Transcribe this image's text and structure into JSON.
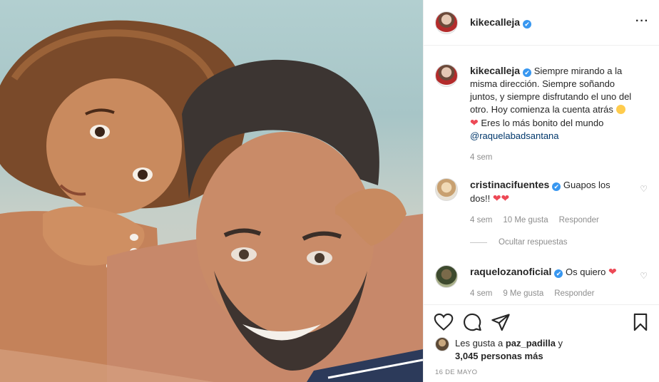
{
  "post": {
    "author": "kikecalleja",
    "verified_mark": "✔",
    "more_icon": "more-horizontal-icon",
    "caption": {
      "username": "kikecalleja",
      "text": "Siempre mirando a la misma dirección. Siempre soñando juntos, y siempre disfrutando el uno del otro. Hoy comienza la cuenta atrás",
      "text2": "Eres lo más bonito del mundo",
      "mention": "@raquelabadsantana",
      "time": "4 sem"
    },
    "comments": [
      {
        "username": "cristinacifuentes",
        "text": "Guapos los dos!!",
        "time": "4 sem",
        "likes": "10 Me gusta",
        "reply": "Responder"
      },
      {
        "username": "raquelozanoficial",
        "text": "Os quiero",
        "time": "4 sem",
        "likes": "9 Me gusta",
        "reply": "Responder"
      }
    ],
    "hide_replies": "Ocultar respuestas",
    "likes": {
      "prefix": "Les gusta a",
      "user": "paz_padilla",
      "suffix": "y",
      "count": "3,045 personas más"
    },
    "date": "16 DE MAYO",
    "icons": {
      "like": "heart-outline-icon",
      "comment": "comment-bubble-icon",
      "share": "paper-plane-icon",
      "save": "bookmark-icon"
    },
    "colors": {
      "heart": "#ed4956",
      "verified": "#3897f0",
      "mention": "#00376b",
      "muted": "#8e8e8e"
    }
  }
}
